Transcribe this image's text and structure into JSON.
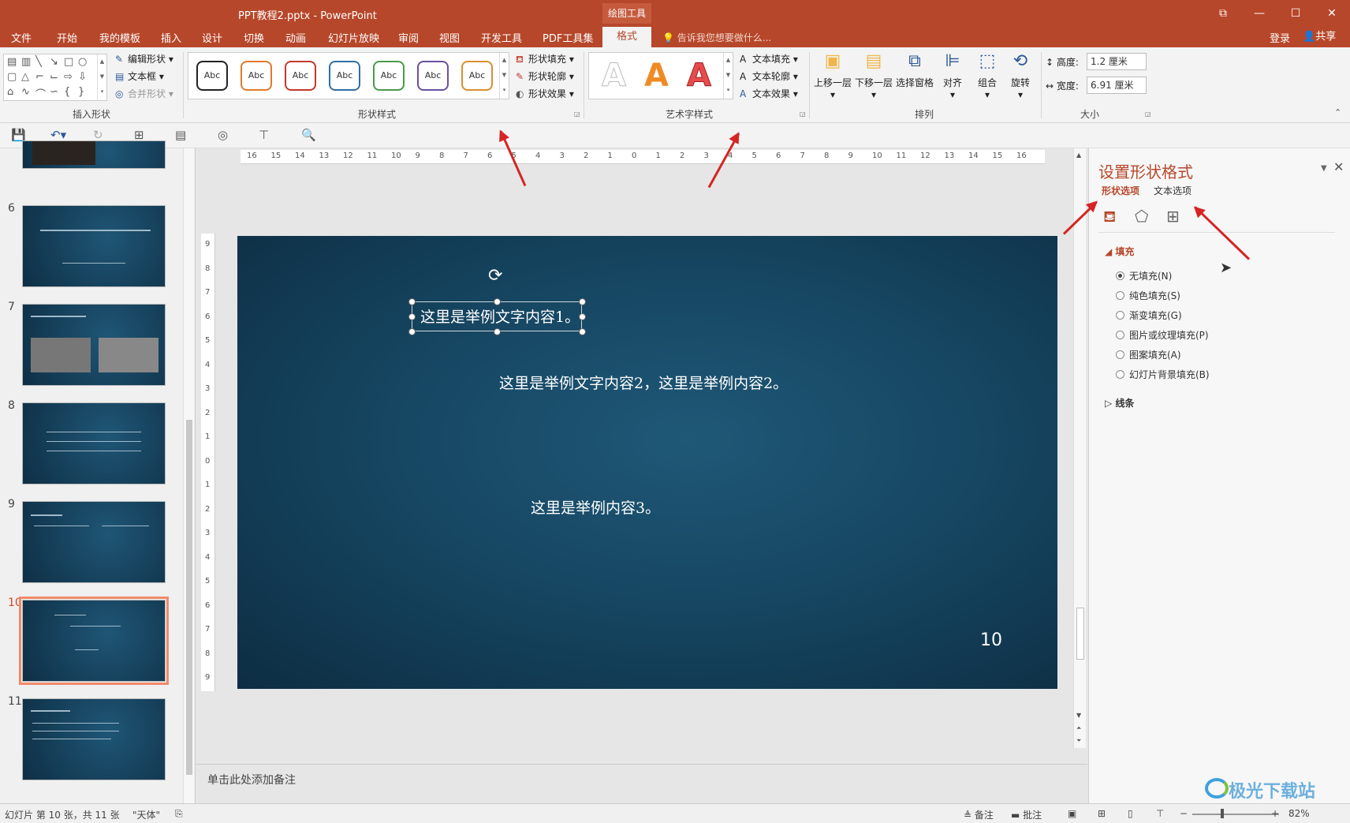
{
  "window": {
    "title": "PPT教程2.pptx - PowerPoint",
    "context_tab_group": "绘图工具",
    "login": "登录",
    "share": "共享"
  },
  "tabs": [
    "文件",
    "开始",
    "我的模板",
    "插入",
    "设计",
    "切换",
    "动画",
    "幻灯片放映",
    "审阅",
    "视图",
    "开发工具",
    "PDF工具集"
  ],
  "active_tab": "格式",
  "tell_me": "告诉我您想要做什么...",
  "ribbon": {
    "insert_shapes": {
      "label": "插入形状",
      "edit_shape": "编辑形状",
      "text_box": "文本框",
      "merge_shapes": "合并形状"
    },
    "shape_styles": {
      "label": "形状样式",
      "swatch_text": "Abc",
      "fill": "形状填充",
      "outline": "形状轮廓",
      "effects": "形状效果",
      "swatch_colors": [
        "#222222",
        "#e07a2e",
        "#c0392b",
        "#2e6fa3",
        "#4a9a4a",
        "#6b4fa0",
        "#d9902f"
      ]
    },
    "wordart": {
      "label": "艺术字样式",
      "glyph": "A",
      "fill": "文本填充",
      "outline": "文本轮廓",
      "effects": "文本效果"
    },
    "arrange": {
      "label": "排列",
      "bring_forward": "上移一层",
      "send_backward": "下移一层",
      "selection_pane": "选择窗格",
      "align": "对齐",
      "group": "组合",
      "rotate": "旋转"
    },
    "size": {
      "label": "大小",
      "height_label": "高度:",
      "height_value": "1.2 厘米",
      "width_label": "宽度:",
      "width_value": "6.91 厘米"
    }
  },
  "ruler": {
    "h_ticks": [
      "16",
      "15",
      "14",
      "13",
      "12",
      "11",
      "10",
      "9",
      "8",
      "7",
      "6",
      "5",
      "4",
      "3",
      "2",
      "1",
      "0",
      "1",
      "2",
      "3",
      "4",
      "5",
      "6",
      "7",
      "8",
      "9",
      "10",
      "11",
      "12",
      "13",
      "14",
      "15",
      "16"
    ],
    "v_ticks": [
      "9",
      "8",
      "7",
      "6",
      "5",
      "4",
      "3",
      "2",
      "1",
      "0",
      "1",
      "2",
      "3",
      "4",
      "5",
      "6",
      "7",
      "8",
      "9"
    ]
  },
  "thumbnails": [
    {
      "num": "6",
      "selected": false
    },
    {
      "num": "7",
      "selected": false
    },
    {
      "num": "8",
      "selected": false
    },
    {
      "num": "9",
      "selected": false
    },
    {
      "num": "10",
      "selected": true
    },
    {
      "num": "11",
      "selected": false
    }
  ],
  "slide": {
    "text1": "这里是举例文字内容1。",
    "text2": "这里是举例文字内容2，这里是举例内容2。",
    "text3": "这里是举例内容3。",
    "page_number": "10"
  },
  "notes_placeholder": "单击此处添加备注",
  "format_pane": {
    "title": "设置形状格式",
    "tab_shape": "形状选项",
    "tab_text": "文本选项",
    "fill_section": "填充",
    "fill_options": [
      "无填充(N)",
      "纯色填充(S)",
      "渐变填充(G)",
      "图片或纹理填充(P)",
      "图案填充(A)",
      "幻灯片背景填充(B)"
    ],
    "fill_selected_index": 0,
    "line_section": "线条"
  },
  "status": {
    "slide_info": "幻灯片 第 10 张，共 11 张",
    "theme": "\"天体\"",
    "notes": "备注",
    "comments": "批注",
    "zoom": "82%"
  },
  "watermark": "极光下载站",
  "colors": {
    "accent": "#b7472a",
    "annotation_arrow": "#d62424"
  }
}
